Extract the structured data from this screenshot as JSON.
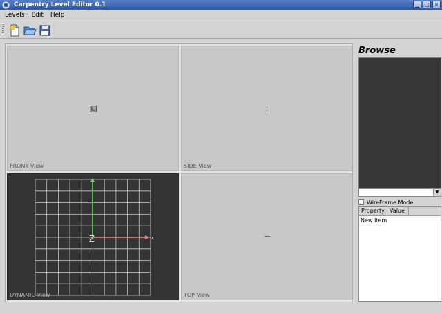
{
  "window": {
    "title": "Carpentry Level Editor 0.1",
    "min_glyph": "▁",
    "max_glyph": "□",
    "close_glyph": "×"
  },
  "menu": {
    "items": [
      "Levels",
      "Edit",
      "Help"
    ]
  },
  "toolbar": {
    "icons": [
      "new-file-icon",
      "open-folder-icon",
      "save-icon"
    ]
  },
  "viewports": {
    "front": {
      "label": "FRONT View"
    },
    "side": {
      "label": "SIDE View"
    },
    "dynamic": {
      "label": "DYNAMIC View",
      "axis_x": "x",
      "axis_z": "Z"
    },
    "top": {
      "label": "TOP View"
    }
  },
  "sidebar": {
    "browse_title": "Browse",
    "combo_arrow": "▼",
    "wireframe_label": "WireFrame Mode",
    "wireframe_checked": false,
    "table_headers": [
      "Property",
      "Value"
    ],
    "table_rows": [
      "New Item"
    ]
  },
  "colors": {
    "titlebar": "#2c58a8",
    "y_axis": "#6bd46b",
    "x_axis": "#e88a8a",
    "grid": "#c9c9c9"
  }
}
